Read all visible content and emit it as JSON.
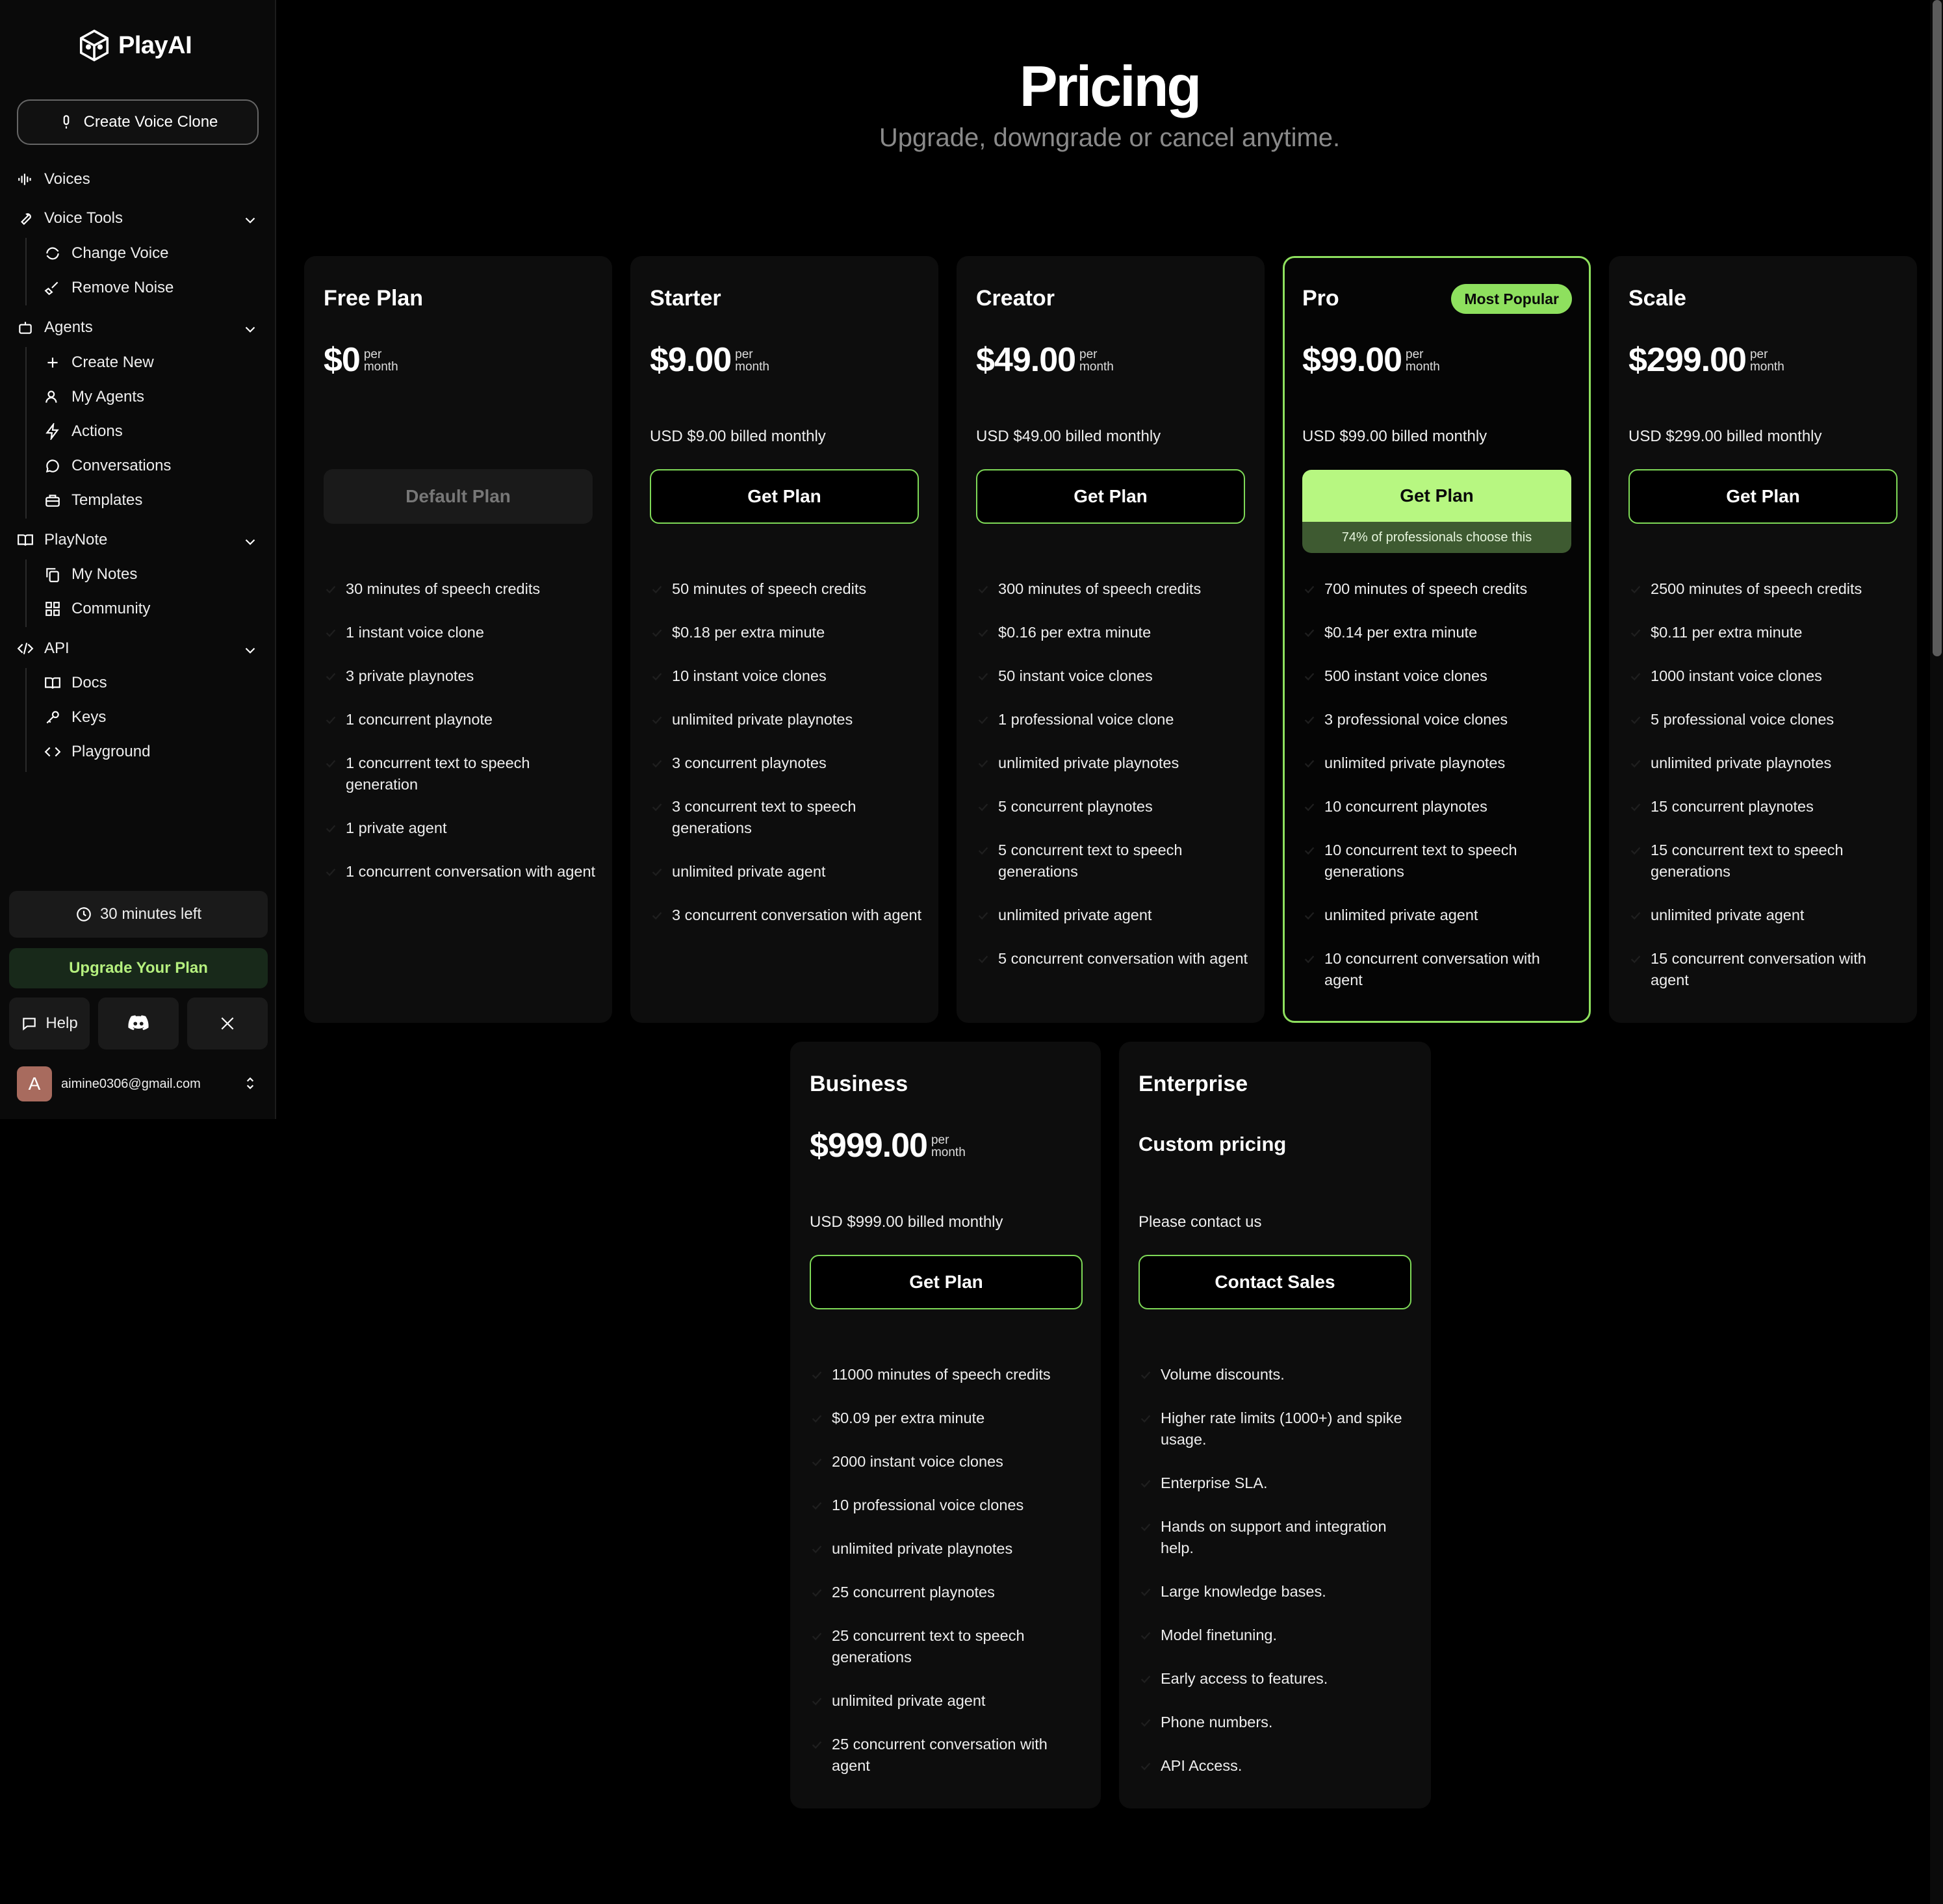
{
  "app": {
    "name": "PlayAI"
  },
  "sidebar": {
    "create_button": "Create Voice Clone",
    "voices": "Voices",
    "voice_tools": {
      "label": "Voice Tools",
      "items": [
        "Change Voice",
        "Remove Noise"
      ]
    },
    "agents": {
      "label": "Agents",
      "items": [
        "Create New",
        "My Agents",
        "Actions",
        "Conversations",
        "Templates"
      ]
    },
    "playnote": {
      "label": "PlayNote",
      "items": [
        "My Notes",
        "Community"
      ]
    },
    "api": {
      "label": "API",
      "items": [
        "Docs",
        "Keys",
        "Playground"
      ]
    },
    "minutes_left": "30 minutes left",
    "upgrade": "Upgrade Your Plan",
    "help": "Help",
    "account": {
      "initial": "A",
      "email": "aimine0306@gmail.com"
    }
  },
  "header": {
    "title": "Pricing",
    "subtitle": "Upgrade, downgrade or cancel anytime."
  },
  "per": "per",
  "month": "month",
  "plans": [
    {
      "name": "Free Plan",
      "price": "$0",
      "billed": "",
      "button": "Default Plan",
      "features": [
        "30 minutes of speech credits",
        "1 instant voice clone",
        "3 private playnotes",
        "1 concurrent playnote",
        "1 concurrent text to speech generation",
        "1 private agent",
        "1 concurrent conversation with agent"
      ]
    },
    {
      "name": "Starter",
      "price": "$9.00",
      "billed": "USD $9.00 billed monthly",
      "button": "Get Plan",
      "features": [
        "50 minutes of speech credits",
        "$0.18 per extra minute",
        "10 instant voice clones",
        "unlimited private playnotes",
        "3 concurrent playnotes",
        "3 concurrent text to speech generations",
        "unlimited private agent",
        "3 concurrent conversation with agent"
      ]
    },
    {
      "name": "Creator",
      "price": "$49.00",
      "billed": "USD $49.00 billed monthly",
      "button": "Get Plan",
      "features": [
        "300 minutes of speech credits",
        "$0.16 per extra minute",
        "50 instant voice clones",
        "1 professional voice clone",
        "unlimited private playnotes",
        "5 concurrent playnotes",
        "5 concurrent text to speech generations",
        "unlimited private agent",
        "5 concurrent conversation with agent"
      ]
    },
    {
      "name": "Pro",
      "badge": "Most Popular",
      "price": "$99.00",
      "billed": "USD $99.00 billed monthly",
      "button": "Get Plan",
      "button_note": "74% of professionals choose this",
      "features": [
        "700 minutes of speech credits",
        "$0.14 per extra minute",
        "500 instant voice clones",
        "3 professional voice clones",
        "unlimited private playnotes",
        "10 concurrent playnotes",
        "10 concurrent text to speech generations",
        "unlimited private agent",
        "10 concurrent conversation with agent"
      ]
    },
    {
      "name": "Scale",
      "price": "$299.00",
      "billed": "USD $299.00 billed monthly",
      "button": "Get Plan",
      "features": [
        "2500 minutes of speech credits",
        "$0.11 per extra minute",
        "1000 instant voice clones",
        "5 professional voice clones",
        "unlimited private playnotes",
        "15 concurrent playnotes",
        "15 concurrent text to speech generations",
        "unlimited private agent",
        "15 concurrent conversation with agent"
      ]
    },
    {
      "name": "Business",
      "price": "$999.00",
      "billed": "USD $999.00 billed monthly",
      "button": "Get Plan",
      "features": [
        "11000 minutes of speech credits",
        "$0.09 per extra minute",
        "2000 instant voice clones",
        "10 professional voice clones",
        "unlimited private playnotes",
        "25 concurrent playnotes",
        "25 concurrent text to speech generations",
        "unlimited private agent",
        "25 concurrent conversation with agent"
      ]
    },
    {
      "name": "Enterprise",
      "custom": "Custom pricing",
      "billed": "Please contact us",
      "button": "Contact Sales",
      "features": [
        "Volume discounts.",
        "Higher rate limits (1000+) and spike usage.",
        "Enterprise SLA.",
        "Hands on support and integration help.",
        "Large knowledge bases.",
        "Model finetuning.",
        "Early access to features.",
        "Phone numbers.",
        "API Access."
      ]
    }
  ],
  "colors": {
    "accent": "#8ee05e",
    "button_highlight": "#b7f781",
    "background": "#000000"
  }
}
